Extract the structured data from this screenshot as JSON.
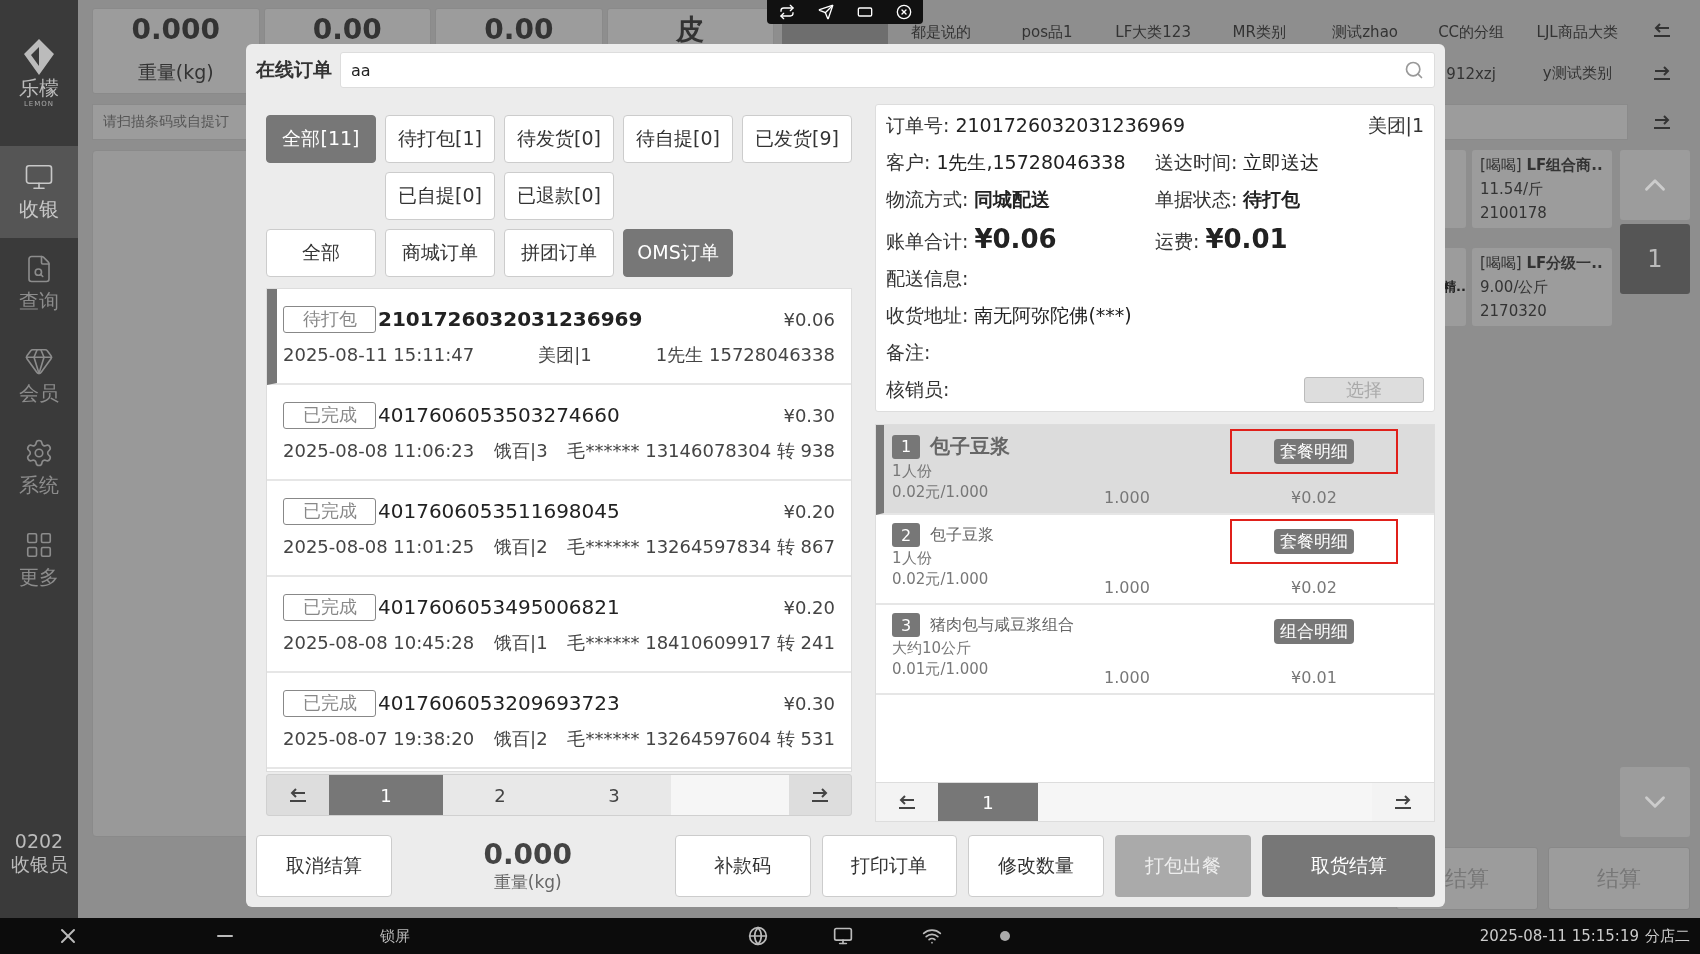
{
  "sidebar": {
    "logo_text": "乐檬",
    "logo_subtext": "LEMON",
    "items": [
      {
        "label": "收银",
        "selected": true
      },
      {
        "label": "查询",
        "selected": false
      },
      {
        "label": "会员",
        "selected": false
      },
      {
        "label": "系统",
        "selected": false
      },
      {
        "label": "更多",
        "selected": false
      }
    ],
    "user_code": "0202",
    "user_role": "收银员"
  },
  "background": {
    "stats": [
      {
        "value": "0.000",
        "label": "重量(kg)"
      },
      {
        "value": "0.00"
      },
      {
        "value": "0.00"
      },
      {
        "value": "皮"
      }
    ],
    "categories": [
      {
        "selected": true
      },
      {
        "label": "都是说的",
        "selected": false
      },
      {
        "label": "pos品1",
        "selected": false
      },
      {
        "label": "LF大类123",
        "selected": false
      },
      {
        "label": "MR类别",
        "selected": false
      },
      {
        "label": "测试zhao",
        "selected": false
      },
      {
        "label": "CC的分组",
        "selected": false
      },
      {
        "label": "LJL商品大类",
        "selected": false
      }
    ],
    "categories_row2": [
      {
        "label": "912xzj",
        "selected": false
      },
      {
        "label": "y测试类别",
        "selected": false
      }
    ],
    "scan_placeholder": "请扫描条码或自提订",
    "partial_product_name": "精..",
    "products": [
      {
        "tag": "[喝喝]",
        "name": "LF组合商..",
        "price": "11.54/斤",
        "code": "2100178"
      },
      {
        "tag": "[喝喝]",
        "name": "LF分级一..",
        "price": "9.00/公斤",
        "code": "2170320"
      }
    ],
    "page": "1",
    "checkout_buttons": [
      "结算",
      "结算"
    ]
  },
  "dialog": {
    "title": "在线订单",
    "search_value": "aa",
    "status_tabs": [
      {
        "label": "全部[11]",
        "selected": true
      },
      {
        "label": "待打包[1]",
        "selected": false
      },
      {
        "label": "待发货[0]",
        "selected": false
      },
      {
        "label": "待自提[0]",
        "selected": false
      },
      {
        "label": "已发货[9]",
        "selected": false
      },
      {
        "label": "已自提[0]",
        "selected": false
      },
      {
        "label": "已退款[0]",
        "selected": false
      }
    ],
    "source_tabs": [
      {
        "label": "全部",
        "selected": false
      },
      {
        "label": "商城订单",
        "selected": false
      },
      {
        "label": "拼团订单",
        "selected": false
      },
      {
        "label": "OMS订单",
        "selected": true
      }
    ],
    "orders": [
      {
        "status": "待打包",
        "order_no": "2101726032031236969",
        "amount": "¥0.06",
        "time": "2025-08-11 15:11:47",
        "source": "美团|1",
        "customer": "1先生 15728046338",
        "selected": true
      },
      {
        "status": "已完成",
        "order_no": "4017606053503274660",
        "amount": "¥0.30",
        "time": "2025-08-08 11:06:23",
        "source": "饿百|3",
        "customer": "毛****** 13146078304 转 938",
        "selected": false
      },
      {
        "status": "已完成",
        "order_no": "4017606053511698045",
        "amount": "¥0.20",
        "time": "2025-08-08 11:01:25",
        "source": "饿百|2",
        "customer": "毛****** 13264597834 转 867",
        "selected": false
      },
      {
        "status": "已完成",
        "order_no": "4017606053495006821",
        "amount": "¥0.20",
        "time": "2025-08-08 10:45:28",
        "source": "饿百|1",
        "customer": "毛****** 18410609917 转 241",
        "selected": false
      },
      {
        "status": "已完成",
        "order_no": "4017606053209693723",
        "amount": "¥0.30",
        "time": "2025-08-07 19:38:20",
        "source": "饿百|2",
        "customer": "毛****** 13264597604 转 531",
        "selected": false
      }
    ],
    "order_pages": [
      {
        "label": "1",
        "selected": true
      },
      {
        "label": "2",
        "selected": false
      },
      {
        "label": "3",
        "selected": false
      }
    ],
    "detail": {
      "order_no_label": "订单号:",
      "order_no": "2101726032031236969",
      "source": "美团|1",
      "pairs": [
        [
          {
            "label": "客户:",
            "value": "1先生,15728046338",
            "kind": "plain"
          },
          {
            "label": "送达时间:",
            "value": "立即送达",
            "kind": "plain"
          }
        ],
        [
          {
            "label": "物流方式:",
            "value": "同城配送",
            "kind": "bold"
          },
          {
            "label": "单据状态:",
            "value": "待打包",
            "kind": "bold"
          }
        ],
        [
          {
            "label": "账单合计:",
            "value": "¥0.06",
            "kind": "amount"
          },
          {
            "label": "运费:",
            "value": "¥0.01",
            "kind": "amount"
          }
        ]
      ],
      "lines": [
        {
          "label": "配送信息:"
        },
        {
          "label": "收货地址:",
          "value": "南无阿弥陀佛(***)"
        },
        {
          "label": "备注:"
        }
      ],
      "verifier_label": "核销员:",
      "verifier_button": "选择",
      "verifier_disabled": true
    },
    "items": [
      {
        "index": "1",
        "name": "包子豆浆",
        "spec": "1人份",
        "unit_price": "0.02元/1.000",
        "qty": "1.000",
        "detail_button": "套餐明细",
        "amount": "¥0.02",
        "selected": true,
        "highlighted": true
      },
      {
        "index": "2",
        "name": "包子豆浆",
        "spec": "1人份",
        "unit_price": "0.02元/1.000",
        "qty": "1.000",
        "detail_button": "套餐明细",
        "amount": "¥0.02",
        "selected": false,
        "highlighted": true
      },
      {
        "index": "3",
        "name": "猪肉包与咸豆浆组合",
        "spec": "大约10公斤",
        "unit_price": "0.01元/1.000",
        "qty": "1.000",
        "detail_button": "组合明细",
        "amount": "¥0.01",
        "selected": false,
        "highlighted": false
      }
    ],
    "item_pages": [
      {
        "label": "1",
        "selected": true
      }
    ],
    "bottom_bar": {
      "cancel": "取消结算",
      "weight_value": "0.000",
      "weight_label": "重量(kg)",
      "actions": [
        {
          "label": "补款码",
          "kind": "normal"
        },
        {
          "label": "打印订单",
          "kind": "normal"
        },
        {
          "label": "修改数量",
          "kind": "normal"
        },
        {
          "label": "打包出餐",
          "kind": "disabled"
        },
        {
          "label": "取货结算",
          "kind": "primary"
        }
      ]
    }
  },
  "taskbar": {
    "lock_label": "锁屏",
    "datetime": "2025-08-11 15:15:19",
    "store": "分店二"
  }
}
